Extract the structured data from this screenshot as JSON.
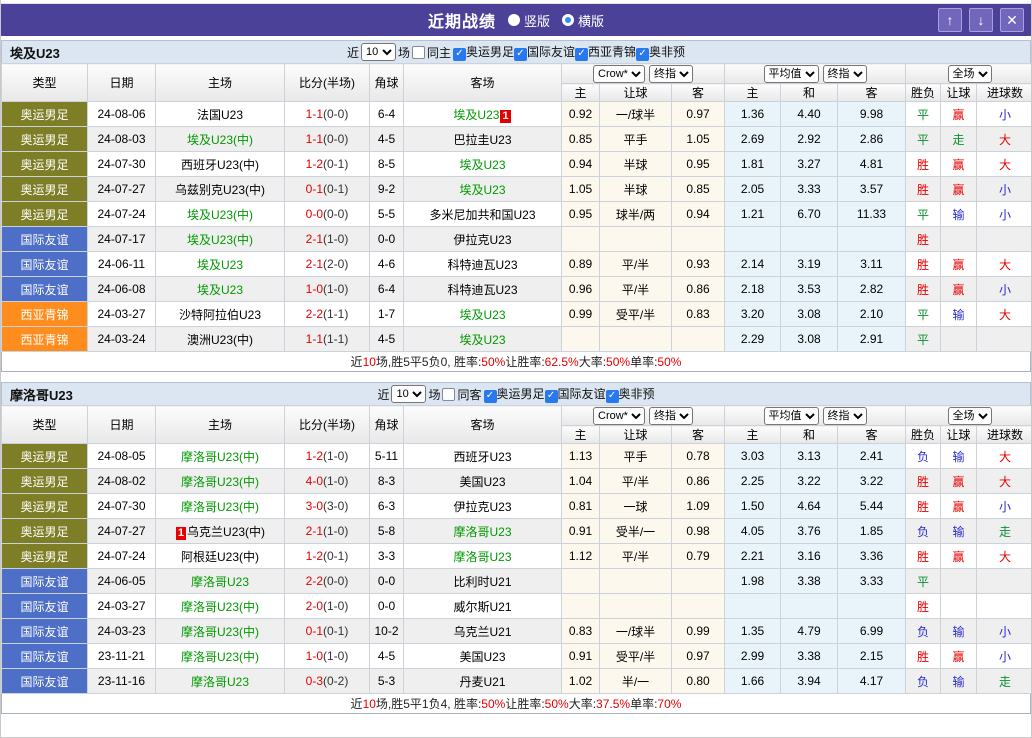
{
  "titlebar": {
    "title": "近期战绩",
    "radio_vertical": "竖版",
    "radio_horizontal": "横版",
    "up_glyph": "↑",
    "down_glyph": "↓",
    "close_glyph": "✕"
  },
  "colors": {
    "titlebar_bg": "#4c4199",
    "section_bar_bg": "#dce6f2",
    "checked_checkbox": "#2878f0",
    "win_red": "#e60000",
    "draw_green": "#0a9030",
    "lose_blue": "#2a2ace",
    "focus_team_green": "#009900"
  },
  "league_colors": {
    "奥运男足": "#7e7e26",
    "国际友谊": "#4e6fc8",
    "西亚青锦": "#ff8d1e"
  },
  "table_header": {
    "type": "类型",
    "date": "日期",
    "home": "主场",
    "score": "比分(半场)",
    "corner": "角球",
    "away": "客场",
    "sub": [
      "主",
      "让球",
      "客",
      "主",
      "和",
      "客",
      "胜负",
      "让球",
      "进球数"
    ],
    "select_crow": "Crow*",
    "select_final": "终指",
    "select_avg": "平均值",
    "select_final2": "终指",
    "select_full": "全场"
  },
  "sections": [
    {
      "team": "埃及U23",
      "near_label": "近",
      "games": "10",
      "games_label": "场",
      "same_label": "同主",
      "same_checked": false,
      "leagues": [
        "奥运男足",
        "国际友谊",
        "西亚青锦",
        "奥非预"
      ],
      "rows": [
        {
          "lg": "奥运男足",
          "dt": "24-08-06",
          "hm": {
            "t": "法国U23"
          },
          "sc": "1-1",
          "hf": "(0-0)",
          "cn": "6-4",
          "aw": {
            "t": "埃及U23",
            "g": true,
            "b2": "1"
          },
          "lh": "0.92",
          "ll": "一/球半",
          "la": "0.97",
          "ah": "1.36",
          "ad": "4.40",
          "aa": "9.98",
          "r1": "平",
          "r2": "赢",
          "r3": "小"
        },
        {
          "lg": "奥运男足",
          "dt": "24-08-03",
          "hm": {
            "t": "埃及U23(中)",
            "g": true
          },
          "sc": "1-1",
          "hf": "(0-0)",
          "cn": "4-5",
          "aw": {
            "t": "巴拉圭U23"
          },
          "lh": "0.85",
          "ll": "平手",
          "la": "1.05",
          "ah": "2.69",
          "ad": "2.92",
          "aa": "2.86",
          "r1": "平",
          "r2": "走",
          "r3": "大"
        },
        {
          "lg": "奥运男足",
          "dt": "24-07-30",
          "hm": {
            "t": "西班牙U23(中)"
          },
          "sc": "1-2",
          "hf": "(0-1)",
          "cn": "8-5",
          "aw": {
            "t": "埃及U23",
            "g": true
          },
          "lh": "0.94",
          "ll": "半球",
          "la": "0.95",
          "ah": "1.81",
          "ad": "3.27",
          "aa": "4.81",
          "r1": "胜",
          "r2": "赢",
          "r3": "大"
        },
        {
          "lg": "奥运男足",
          "dt": "24-07-27",
          "hm": {
            "t": "乌兹别克U23(中)"
          },
          "sc": "0-1",
          "hf": "(0-1)",
          "cn": "9-2",
          "aw": {
            "t": "埃及U23",
            "g": true
          },
          "lh": "1.05",
          "ll": "半球",
          "la": "0.85",
          "ah": "2.05",
          "ad": "3.33",
          "aa": "3.57",
          "r1": "胜",
          "r2": "赢",
          "r3": "小"
        },
        {
          "lg": "奥运男足",
          "dt": "24-07-24",
          "hm": {
            "t": "埃及U23(中)",
            "g": true
          },
          "sc": "0-0",
          "hf": "(0-0)",
          "cn": "5-5",
          "aw": {
            "t": "多米尼加共和国U23"
          },
          "lh": "0.95",
          "ll": "球半/两",
          "la": "0.94",
          "ah": "1.21",
          "ad": "6.70",
          "aa": "11.33",
          "r1": "平",
          "r2": "输",
          "r3": "小"
        },
        {
          "lg": "国际友谊",
          "dt": "24-07-17",
          "hm": {
            "t": "埃及U23(中)",
            "g": true
          },
          "sc": "2-1",
          "hf": "(1-0)",
          "cn": "0-0",
          "aw": {
            "t": "伊拉克U23"
          },
          "lh": "",
          "ll": "",
          "la": "",
          "ah": "",
          "ad": "",
          "aa": "",
          "r1": "胜",
          "r2": "",
          "r3": ""
        },
        {
          "lg": "国际友谊",
          "dt": "24-06-11",
          "hm": {
            "t": "埃及U23",
            "g": true
          },
          "sc": "2-1",
          "hf": "(2-0)",
          "cn": "4-6",
          "aw": {
            "t": "科特迪瓦U23"
          },
          "lh": "0.89",
          "ll": "平/半",
          "la": "0.93",
          "ah": "2.14",
          "ad": "3.19",
          "aa": "3.11",
          "r1": "胜",
          "r2": "赢",
          "r3": "大"
        },
        {
          "lg": "国际友谊",
          "dt": "24-06-08",
          "hm": {
            "t": "埃及U23",
            "g": true
          },
          "sc": "1-0",
          "hf": "(1-0)",
          "cn": "6-4",
          "aw": {
            "t": "科特迪瓦U23"
          },
          "lh": "0.96",
          "ll": "平/半",
          "la": "0.86",
          "ah": "2.18",
          "ad": "3.53",
          "aa": "2.82",
          "r1": "胜",
          "r2": "赢",
          "r3": "小"
        },
        {
          "lg": "西亚青锦",
          "dt": "24-03-27",
          "hm": {
            "t": "沙特阿拉伯U23"
          },
          "sc": "2-2",
          "hf": "(1-1)",
          "cn": "1-7",
          "aw": {
            "t": "埃及U23",
            "g": true
          },
          "lh": "0.99",
          "ll": "受平/半",
          "la": "0.83",
          "ah": "3.20",
          "ad": "3.08",
          "aa": "2.10",
          "r1": "平",
          "r2": "输",
          "r3": "大"
        },
        {
          "lg": "西亚青锦",
          "dt": "24-03-24",
          "hm": {
            "t": "澳洲U23(中)"
          },
          "sc": "1-1",
          "hf": "(1-1)",
          "cn": "4-5",
          "aw": {
            "t": "埃及U23",
            "g": true
          },
          "lh": "",
          "ll": "",
          "la": "",
          "ah": "2.29",
          "ad": "3.08",
          "aa": "2.91",
          "r1": "平",
          "r2": "",
          "r3": ""
        }
      ],
      "summary": [
        {
          "t": "近"
        },
        {
          "t": "10",
          "r": true
        },
        {
          "t": "场,胜5平5负0, 胜率:"
        },
        {
          "t": "50%",
          "r": true
        },
        {
          "t": " 让胜率:"
        },
        {
          "t": "62.5%",
          "r": true
        },
        {
          "t": " 大率:"
        },
        {
          "t": "50%",
          "r": true
        },
        {
          "t": " 单率:"
        },
        {
          "t": "50%",
          "r": true
        }
      ]
    },
    {
      "team": "摩洛哥U23",
      "near_label": "近",
      "games": "10",
      "games_label": "场",
      "same_label": "同客",
      "same_checked": false,
      "leagues": [
        "奥运男足",
        "国际友谊",
        "奥非预"
      ],
      "rows": [
        {
          "lg": "奥运男足",
          "dt": "24-08-05",
          "hm": {
            "t": "摩洛哥U23(中)",
            "g": true
          },
          "sc": "1-2",
          "hf": "(1-0)",
          "cn": "5-11",
          "aw": {
            "t": "西班牙U23"
          },
          "lh": "1.13",
          "ll": "平手",
          "la": "0.78",
          "ah": "3.03",
          "ad": "3.13",
          "aa": "2.41",
          "r1": "负",
          "r2": "输",
          "r3": "大"
        },
        {
          "lg": "奥运男足",
          "dt": "24-08-02",
          "hm": {
            "t": "摩洛哥U23(中)",
            "g": true
          },
          "sc": "4-0",
          "hf": "(1-0)",
          "cn": "8-3",
          "aw": {
            "t": "美国U23"
          },
          "lh": "1.04",
          "ll": "平/半",
          "la": "0.86",
          "ah": "2.25",
          "ad": "3.22",
          "aa": "3.22",
          "r1": "胜",
          "r2": "赢",
          "r3": "大"
        },
        {
          "lg": "奥运男足",
          "dt": "24-07-30",
          "hm": {
            "t": "摩洛哥U23(中)",
            "g": true
          },
          "sc": "3-0",
          "hf": "(3-0)",
          "cn": "6-3",
          "aw": {
            "t": "伊拉克U23"
          },
          "lh": "0.81",
          "ll": "一球",
          "la": "1.09",
          "ah": "1.50",
          "ad": "4.64",
          "aa": "5.44",
          "r1": "胜",
          "r2": "赢",
          "r3": "小"
        },
        {
          "lg": "奥运男足",
          "dt": "24-07-27",
          "hm": {
            "t": "乌克兰U23(中)",
            "b1": "1"
          },
          "sc": "2-1",
          "hf": "(1-0)",
          "cn": "5-8",
          "aw": {
            "t": "摩洛哥U23",
            "g": true
          },
          "lh": "0.91",
          "ll": "受半/一",
          "la": "0.98",
          "ah": "4.05",
          "ad": "3.76",
          "aa": "1.85",
          "r1": "负",
          "r2": "输",
          "r3": "走"
        },
        {
          "lg": "奥运男足",
          "dt": "24-07-24",
          "hm": {
            "t": "阿根廷U23(中)"
          },
          "sc": "1-2",
          "hf": "(0-1)",
          "cn": "3-3",
          "aw": {
            "t": "摩洛哥U23",
            "g": true
          },
          "lh": "1.12",
          "ll": "平/半",
          "la": "0.79",
          "ah": "2.21",
          "ad": "3.16",
          "aa": "3.36",
          "r1": "胜",
          "r2": "赢",
          "r3": "大"
        },
        {
          "lg": "国际友谊",
          "dt": "24-06-05",
          "hm": {
            "t": "摩洛哥U23",
            "g": true
          },
          "sc": "2-2",
          "hf": "(0-0)",
          "cn": "0-0",
          "aw": {
            "t": "比利时U21"
          },
          "lh": "",
          "ll": "",
          "la": "",
          "ah": "1.98",
          "ad": "3.38",
          "aa": "3.33",
          "r1": "平",
          "r2": "",
          "r3": ""
        },
        {
          "lg": "国际友谊",
          "dt": "24-03-27",
          "hm": {
            "t": "摩洛哥U23(中)",
            "g": true
          },
          "sc": "2-0",
          "hf": "(1-0)",
          "cn": "0-0",
          "aw": {
            "t": "威尔斯U21"
          },
          "lh": "",
          "ll": "",
          "la": "",
          "ah": "",
          "ad": "",
          "aa": "",
          "r1": "胜",
          "r2": "",
          "r3": ""
        },
        {
          "lg": "国际友谊",
          "dt": "24-03-23",
          "hm": {
            "t": "摩洛哥U23(中)",
            "g": true
          },
          "sc": "0-1",
          "hf": "(0-1)",
          "cn": "10-2",
          "aw": {
            "t": "乌克兰U21"
          },
          "lh": "0.83",
          "ll": "一/球半",
          "la": "0.99",
          "ah": "1.35",
          "ad": "4.79",
          "aa": "6.99",
          "r1": "负",
          "r2": "输",
          "r3": "小"
        },
        {
          "lg": "国际友谊",
          "dt": "23-11-21",
          "hm": {
            "t": "摩洛哥U23(中)",
            "g": true
          },
          "sc": "1-0",
          "hf": "(1-0)",
          "cn": "4-5",
          "aw": {
            "t": "美国U23"
          },
          "lh": "0.91",
          "ll": "受平/半",
          "la": "0.97",
          "ah": "2.99",
          "ad": "3.38",
          "aa": "2.15",
          "r1": "胜",
          "r2": "赢",
          "r3": "小"
        },
        {
          "lg": "国际友谊",
          "dt": "23-11-16",
          "hm": {
            "t": "摩洛哥U23",
            "g": true
          },
          "sc": "0-3",
          "hf": "(0-2)",
          "cn": "5-3",
          "aw": {
            "t": "丹麦U21"
          },
          "lh": "1.02",
          "ll": "半/一",
          "la": "0.80",
          "ah": "1.66",
          "ad": "3.94",
          "aa": "4.17",
          "r1": "负",
          "r2": "输",
          "r3": "走"
        }
      ],
      "summary": [
        {
          "t": "近"
        },
        {
          "t": "10",
          "r": true
        },
        {
          "t": "场,胜5平1负4, 胜率:"
        },
        {
          "t": "50%",
          "r": true
        },
        {
          "t": " 让胜率:"
        },
        {
          "t": "50%",
          "r": true
        },
        {
          "t": " 大率:"
        },
        {
          "t": "37.5%",
          "r": true
        },
        {
          "t": " 单率:"
        },
        {
          "t": "70%",
          "r": true
        }
      ]
    }
  ]
}
